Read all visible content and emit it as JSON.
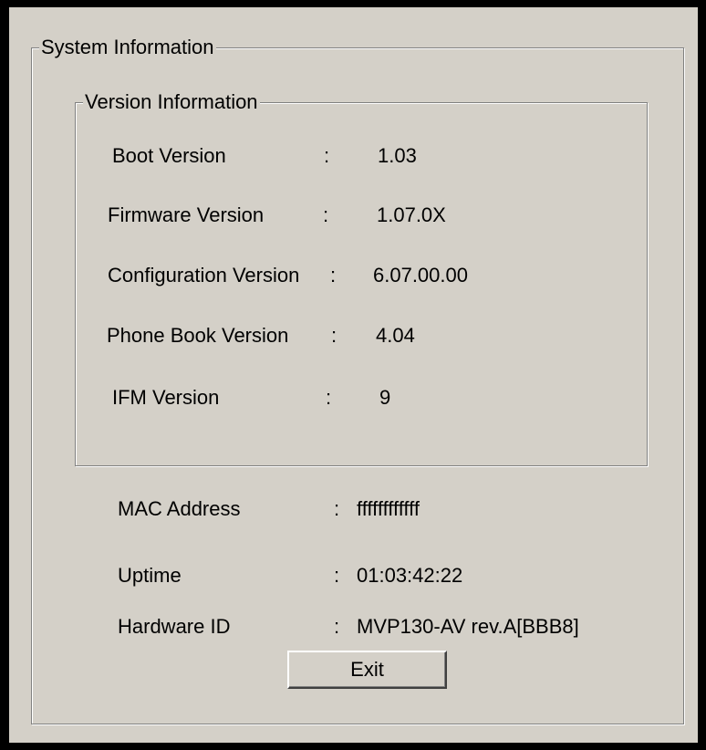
{
  "system_group": {
    "title": "System Information"
  },
  "version_group": {
    "title": "Version Information",
    "rows": [
      {
        "label": "Boot Version",
        "sep": ":",
        "value": "1.03"
      },
      {
        "label": "Firmware Version",
        "sep": ":",
        "value": "1.07.0X"
      },
      {
        "label": "Configuration Version",
        "sep": ":",
        "value": "6.07.00.00"
      },
      {
        "label": "Phone Book Version",
        "sep": ":",
        "value": "4.04"
      },
      {
        "label": "IFM Version",
        "sep": ":",
        "value": "9"
      }
    ]
  },
  "info_rows": [
    {
      "label": "MAC Address",
      "sep": ":",
      "value": "ffffffffffff"
    },
    {
      "label": "Uptime",
      "sep": ":",
      "value": "01:03:42:22"
    },
    {
      "label": "Hardware ID",
      "sep": ":",
      "value": "MVP130-AV rev.A[BBB8]"
    }
  ],
  "buttons": {
    "exit_label": "Exit"
  }
}
